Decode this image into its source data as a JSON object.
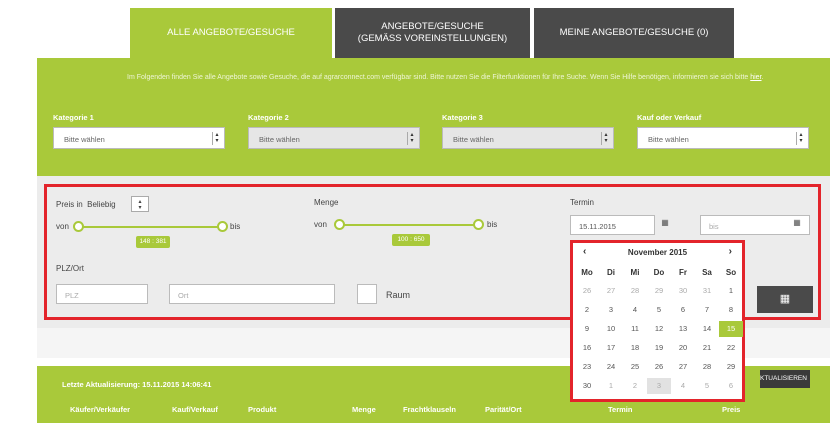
{
  "tabs": [
    {
      "line1": "ALLE ANGEBOTE/GESUCHE",
      "line2": ""
    },
    {
      "line1": "ANGEBOTE/GESUCHE",
      "line2": "(GEMÄSS VOREINSTELLUNGEN)"
    },
    {
      "line1": "MEINE ANGEBOTE/GESUCHE (0)",
      "line2": ""
    }
  ],
  "info": {
    "text_before_link": "Im Folgenden finden Sie alle Angebote sowie Gesuche, die auf agrarconnect.com verfügbar sind. Bitte nutzen Sie die Filterfunktionen für Ihre Suche. Wenn Sie Hilfe benötigen, informieren sie sich bitte ",
    "link": "hier",
    "text_after_link": "."
  },
  "filters": [
    {
      "label": "Kategorie 1",
      "value": "Bitte wählen"
    },
    {
      "label": "Kategorie 2",
      "value": "Bitte wählen"
    },
    {
      "label": "Kategorie 3",
      "value": "Bitte wählen"
    },
    {
      "label": "Kauf oder Verkauf",
      "value": "Bitte wählen"
    }
  ],
  "preis": {
    "label": "Preis in",
    "currency": "Beliebig",
    "from": "von",
    "to": "bis",
    "range": "148 : 381"
  },
  "menge": {
    "label": "Menge",
    "from": "von",
    "to": "bis",
    "range": "100 : 650"
  },
  "termin": {
    "label": "Termin",
    "from_value": "15.11.2015",
    "to_placeholder": "bis"
  },
  "location": {
    "label": "PLZ/Ort",
    "plz_placeholder": "PLZ",
    "ort_placeholder": "Ort",
    "raum_label": "Raum"
  },
  "datepicker": {
    "prev": "‹",
    "next": "›",
    "title": "November 2015",
    "weekdays": [
      "Mo",
      "Di",
      "Mi",
      "Do",
      "Fr",
      "Sa",
      "So"
    ],
    "weeks": [
      [
        "26",
        "27",
        "28",
        "29",
        "30",
        "31",
        "1"
      ],
      [
        "2",
        "3",
        "4",
        "5",
        "6",
        "7",
        "8"
      ],
      [
        "9",
        "10",
        "11",
        "12",
        "13",
        "14",
        "15"
      ],
      [
        "16",
        "17",
        "18",
        "19",
        "20",
        "21",
        "22"
      ],
      [
        "23",
        "24",
        "25",
        "26",
        "27",
        "28",
        "29"
      ],
      [
        "30",
        "1",
        "2",
        "3",
        "4",
        "5",
        "6"
      ]
    ],
    "selected": "15"
  },
  "results": {
    "last_update": "Letzte Aktualisierung: 15.11.2015 14:06:41",
    "refresh_label": "KTUALISIEREN",
    "columns": [
      "Käufer/Verkäufer",
      "Kauf/Verkauf",
      "Produkt",
      "Menge",
      "Frachtklauseln",
      "Parität/Ort",
      "Termin",
      "Preis"
    ]
  },
  "colors": {
    "accent": "#a9c93a",
    "dark_tab": "#4a4a4a",
    "highlight_border": "#e3242b"
  },
  "icons": {
    "calendar": "calendar-icon",
    "grid": "grid-icon",
    "select_arrow": "select-arrow-icon"
  }
}
